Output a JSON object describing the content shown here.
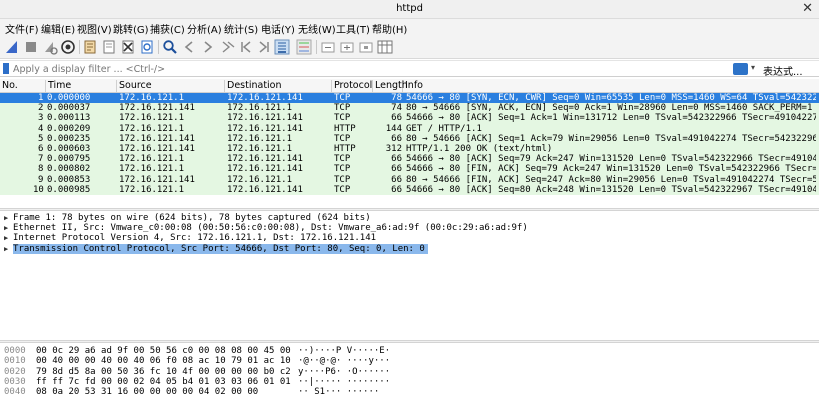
{
  "window": {
    "title": "httpd"
  },
  "menu": [
    "文件(F)",
    "编辑(E)",
    "视图(V)",
    "跳转(G)",
    "捕获(C)",
    "分析(A)",
    "统计(S)",
    "电话(Y)",
    "无线(W)",
    "工具(T)",
    "帮助(H)"
  ],
  "toolbar_icons": [
    "shark-fin-start-icon",
    "stop-square-icon",
    "restart-capture-icon",
    "capture-options-icon",
    "open-file-icon",
    "save-file-icon",
    "close-file-icon",
    "reload-file-icon",
    "find-packet-icon",
    "go-back-icon",
    "go-forward-icon",
    "go-to-packet-icon",
    "go-first-icon",
    "go-last-icon",
    "auto-scroll-icon",
    "colorize-icon",
    "zoom-in-icon",
    "zoom-out-icon",
    "normal-size-icon",
    "resize-columns-icon"
  ],
  "filter": {
    "placeholder": "Apply a display filter ... <Ctrl-/>",
    "value": "",
    "expression_label": "表达式..."
  },
  "columns": [
    "No.",
    "Time",
    "Source",
    "Destination",
    "Protocol",
    "Length",
    "Info"
  ],
  "packets": [
    {
      "no": "1",
      "time": "0.000000",
      "src": "172.16.121.1",
      "dst": "172.16.121.141",
      "proto": "TCP",
      "len": "78",
      "info": "54666 → 80 [SYN, ECN, CWR] Seq=0 Win=65535 Len=0 MSS=1460 WS=64 TSval=54232296…"
    },
    {
      "no": "2",
      "time": "0.000037",
      "src": "172.16.121.141",
      "dst": "172.16.121.1",
      "proto": "TCP",
      "len": "74",
      "info": "80 → 54666 [SYN, ACK, ECN] Seq=0 Ack=1 Win=28960 Len=0 MSS=1460 SACK_PERM=1 TSva…"
    },
    {
      "no": "3",
      "time": "0.000113",
      "src": "172.16.121.1",
      "dst": "172.16.121.141",
      "proto": "TCP",
      "len": "66",
      "info": "54666 → 80 [ACK] Seq=1 Ack=1 Win=131712 Len=0 TSval=542322966 TSecr=491042273"
    },
    {
      "no": "4",
      "time": "0.000209",
      "src": "172.16.121.1",
      "dst": "172.16.121.141",
      "proto": "HTTP",
      "len": "144",
      "info": "GET / HTTP/1.1"
    },
    {
      "no": "5",
      "time": "0.000235",
      "src": "172.16.121.141",
      "dst": "172.16.121.1",
      "proto": "TCP",
      "len": "66",
      "info": "80 → 54666 [ACK] Seq=1 Ack=79 Win=29056 Len=0 TSval=491042274 TSecr=542322966"
    },
    {
      "no": "6",
      "time": "0.000603",
      "src": "172.16.121.141",
      "dst": "172.16.121.1",
      "proto": "HTTP",
      "len": "312",
      "info": "HTTP/1.1 200 OK  (text/html)"
    },
    {
      "no": "7",
      "time": "0.000795",
      "src": "172.16.121.1",
      "dst": "172.16.121.141",
      "proto": "TCP",
      "len": "66",
      "info": "54666 → 80 [ACK] Seq=79 Ack=247 Win=131520 Len=0 TSval=542322966 TSecr=491042274"
    },
    {
      "no": "8",
      "time": "0.000802",
      "src": "172.16.121.1",
      "dst": "172.16.121.141",
      "proto": "TCP",
      "len": "66",
      "info": "54666 → 80 [FIN, ACK] Seq=79 Ack=247 Win=131520 Len=0 TSval=542322966 TSecr=491…"
    },
    {
      "no": "9",
      "time": "0.000853",
      "src": "172.16.121.141",
      "dst": "172.16.121.1",
      "proto": "TCP",
      "len": "66",
      "info": "80 → 54666 [FIN, ACK] Seq=247 Ack=80 Win=29056 Len=0 TSval=491042274 TSecr=5423…"
    },
    {
      "no": "10",
      "time": "0.000985",
      "src": "172.16.121.1",
      "dst": "172.16.121.141",
      "proto": "TCP",
      "len": "66",
      "info": "54666 → 80 [ACK] Seq=80 Ack=248 Win=131520 Len=0 TSval=542322967 TSecr=491042274"
    }
  ],
  "details": [
    "Frame 1: 78 bytes on wire (624 bits), 78 bytes captured (624 bits)",
    "Ethernet II, Src: Vmware_c0:00:08 (00:50:56:c0:00:08), Dst: Vmware_a6:ad:9f (00:0c:29:a6:ad:9f)",
    "Internet Protocol Version 4, Src: 172.16.121.1, Dst: 172.16.121.141",
    "Transmission Control Protocol, Src Port: 54666, Dst Port: 80, Seq: 0, Len: 0"
  ],
  "bytes": [
    {
      "off": "0000",
      "hex": "00 0c 29 a6 ad 9f 00 50  56 c0 00 08 08 00 45 00",
      "ascii": "··)····P V·····E·"
    },
    {
      "off": "0010",
      "hex": "00 40 00 00 40 00 40 06  f0 08 ac 10 79 01 ac 10",
      "ascii": "·@··@·@· ····y···"
    },
    {
      "off": "0020",
      "hex": "79 8d d5 8a 00 50 36 fc  10 4f 00 00 00 00 b0 c2",
      "ascii": "y····P6· ·O······"
    },
    {
      "off": "0030",
      "hex": "ff ff 7c fd 00 00 02 04  05 b4 01 03 03 06 01 01",
      "ascii": "··|····· ········"
    },
    {
      "off": "0040",
      "hex": "08 0a 20 53 31 16 00 00  00 00 04 02 00 00",
      "ascii": "·· S1··· ······"
    }
  ]
}
